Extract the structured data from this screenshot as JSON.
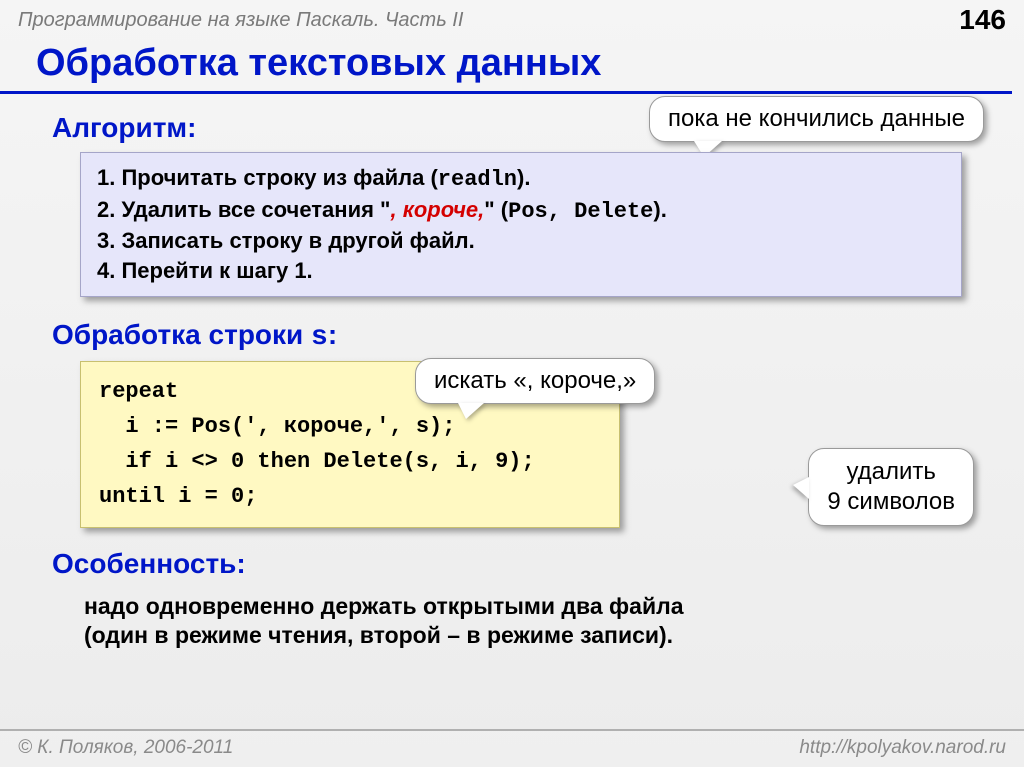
{
  "header": {
    "course": "Программирование на языке Паскаль. Часть II",
    "page": "146"
  },
  "title": "Обработка текстовых данных",
  "callouts": {
    "c1": "пока не кончились данные",
    "c2": "искать «, короче,»",
    "c3_l1": "удалить",
    "c3_l2": "9 символов"
  },
  "sections": {
    "algoritm": "Алгоритм:",
    "obrabotka_pre": "Обработка строки ",
    "obrabotka_s": "s",
    "obrabotka_post": ":",
    "osobennost": "Особенность:"
  },
  "algo": {
    "l1a": "1. Прочитать строку из файла (",
    "l1b": "readln",
    "l1c": ").",
    "l2a": "2. Удалить все сочетания \"",
    "l2b": ", короче,",
    "l2c": "\" (",
    "l2d": "Pos",
    "l2e": ", ",
    "l2f": "Delete",
    "l2g": ").",
    "l3": "3. Записать строку в другой файл.",
    "l4": "4. Перейти к шагу 1."
  },
  "code": "repeat\n  i := Pos(', короче,', s);\n  if i <> 0 then Delete(s, i, 9);\nuntil i = 0;",
  "note": {
    "l1": "надо одновременно держать открытыми два файла",
    "l2": "(один в режиме чтения, второй – в режиме записи)."
  },
  "footer": {
    "left": "© К. Поляков, 2006-2011",
    "right": "http://kpolyakov.narod.ru"
  }
}
